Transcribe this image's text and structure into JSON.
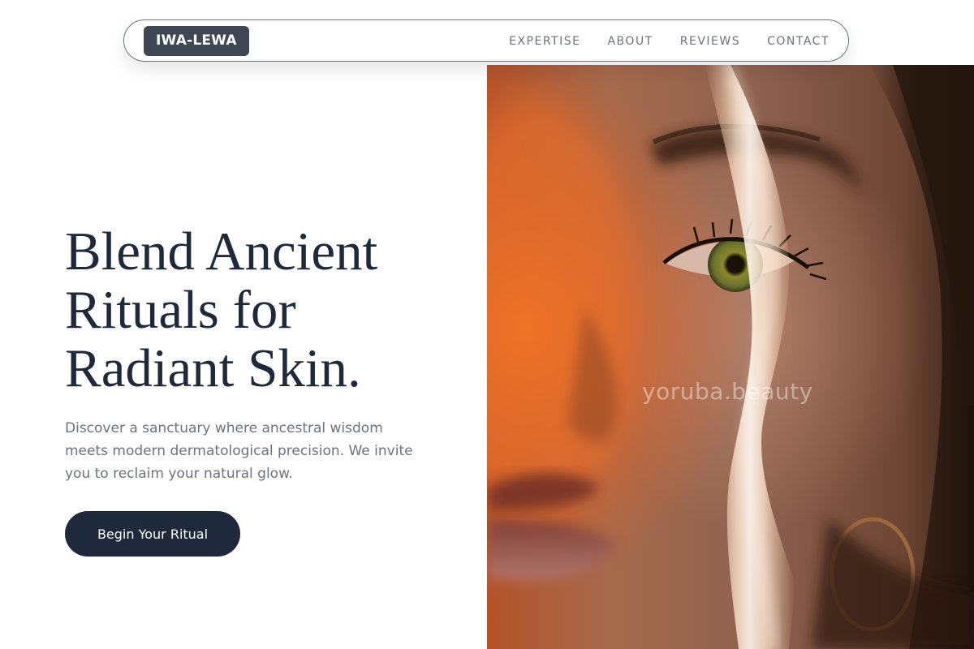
{
  "brand": {
    "logo_text": "IWA-LEWA",
    "logo_bg_color": "#3f4654"
  },
  "nav": {
    "links": [
      {
        "label": "EXPERTISE"
      },
      {
        "label": "ABOUT"
      },
      {
        "label": "REVIEWS"
      },
      {
        "label": "CONTACT"
      }
    ]
  },
  "hero": {
    "headline_lines": [
      "Blend Ancient",
      "Rituals for",
      "Radiant Skin."
    ],
    "subtext": "Discover a sanctuary where ancestral wisdom meets modern dermatological precision. We invite you to reclaim your natural glow.",
    "cta_label": "Begin Your Ritual",
    "image": {
      "subject": "close-up portrait with a streak of warm light across the face",
      "watermark": "yoruba.beauty"
    }
  },
  "colors": {
    "text_primary": "#1e293b",
    "text_muted": "#6b7280",
    "button_bg": "#1e293b",
    "button_text": "#ffffff"
  }
}
